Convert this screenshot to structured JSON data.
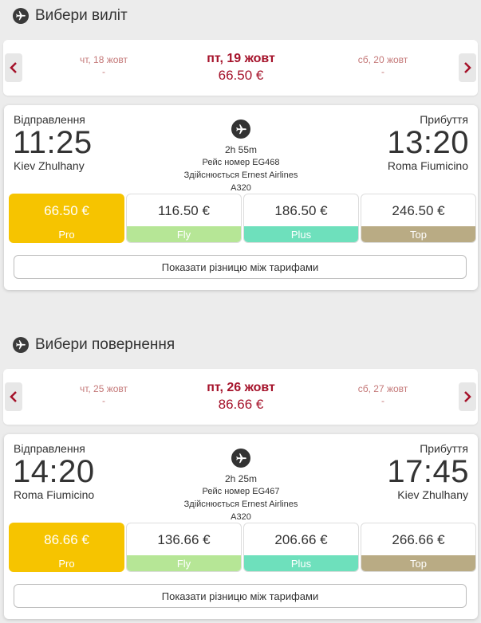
{
  "outbound": {
    "section_title": "Вибери виліт",
    "dates": {
      "prev": {
        "date": "чт, 18 жовт",
        "price": "-"
      },
      "current": {
        "date": "пт, 19 жовт",
        "price": "66.50 €"
      },
      "next": {
        "date": "сб, 20 жовт",
        "price": "-"
      }
    },
    "flight": {
      "departure_label": "Відправлення",
      "departure_time": "11:25",
      "departure_airport": "Kiev Zhulhany",
      "arrival_label": "Прибуття",
      "arrival_time": "13:20",
      "arrival_airport": "Roma Fiumicino",
      "duration": "2h 55m",
      "flight_number": "Рейс номер EG468",
      "operator": "Здійснюється Ernest Airlines",
      "aircraft": "A320"
    },
    "tariffs": [
      {
        "price": "66.50 €",
        "name": "Pro"
      },
      {
        "price": "116.50 €",
        "name": "Fly"
      },
      {
        "price": "186.50 €",
        "name": "Plus"
      },
      {
        "price": "246.50 €",
        "name": "Top"
      }
    ],
    "compare_label": "Показати різницю між тарифами"
  },
  "return": {
    "section_title": "Вибери повернення",
    "dates": {
      "prev": {
        "date": "чт, 25 жовт",
        "price": "-"
      },
      "current": {
        "date": "пт, 26 жовт",
        "price": "86.66 €"
      },
      "next": {
        "date": "сб, 27 жовт",
        "price": "-"
      }
    },
    "flight": {
      "departure_label": "Відправлення",
      "departure_time": "14:20",
      "departure_airport": "Roma Fiumicino",
      "arrival_label": "Прибуття",
      "arrival_time": "17:45",
      "arrival_airport": "Kiev Zhulhany",
      "duration": "2h 25m",
      "flight_number": "Рейс номер EG467",
      "operator": "Здійснюється Ernest Airlines",
      "aircraft": "A320"
    },
    "tariffs": [
      {
        "price": "86.66 €",
        "name": "Pro"
      },
      {
        "price": "136.66 €",
        "name": "Fly"
      },
      {
        "price": "206.66 €",
        "name": "Plus"
      },
      {
        "price": "266.66 €",
        "name": "Top"
      }
    ],
    "compare_label": "Показати різницю між тарифами"
  },
  "icons": {
    "section": "airplane-icon",
    "flight": "airplane-icon",
    "prev": "chevron-left-icon",
    "next": "chevron-right-icon"
  },
  "colors": {
    "accent_red": "#a5122a",
    "pro": "#f6c400",
    "fly": "#b6e696",
    "plus": "#6ee0bc",
    "top": "#b9ab84"
  }
}
